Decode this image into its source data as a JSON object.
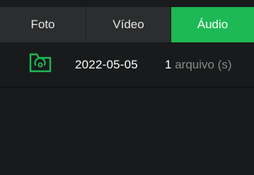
{
  "tabs": [
    {
      "label": "Foto",
      "active": false
    },
    {
      "label": "Vídeo",
      "active": false
    },
    {
      "label": "Áudio",
      "active": true
    }
  ],
  "colors": {
    "accent": "#1db954",
    "background": "#181a1b",
    "tab_background": "#2c2d2e",
    "muted_text": "#8a8a8a"
  },
  "folders": [
    {
      "icon": "audio-folder-icon",
      "date": "2022-05-05",
      "count": "1",
      "count_unit": "arquivo (s)"
    }
  ]
}
